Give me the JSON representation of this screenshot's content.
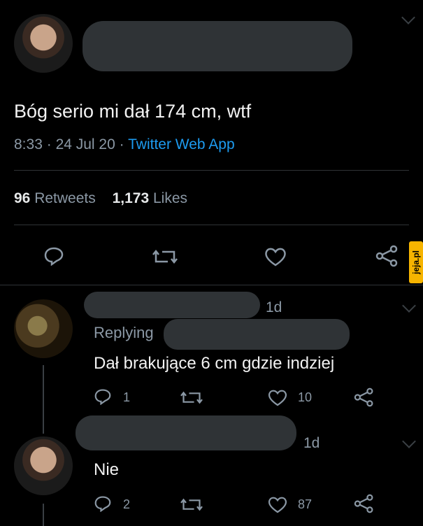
{
  "tweet": {
    "text": "Bóg serio mi dał 174 cm, wtf",
    "time": "8:33",
    "sep1": "·",
    "date": "24 Jul 20",
    "sep2": "·",
    "source": "Twitter Web App",
    "retweets_count": "96",
    "retweets_label": "Retweets",
    "likes_count": "1,173",
    "likes_label": "Likes"
  },
  "reply1": {
    "age": "1d",
    "replying": "Replying",
    "text": "Dał brakujące 6 cm gdzie indziej",
    "replies": "1",
    "likes": "10"
  },
  "reply2": {
    "age": "1d",
    "text": "Nie",
    "replies": "2",
    "likes": "87"
  },
  "watermark": "jeja.pl",
  "icons": [
    "reply-icon",
    "retweet-icon",
    "like-icon",
    "share-icon",
    "chevron-down-icon"
  ]
}
